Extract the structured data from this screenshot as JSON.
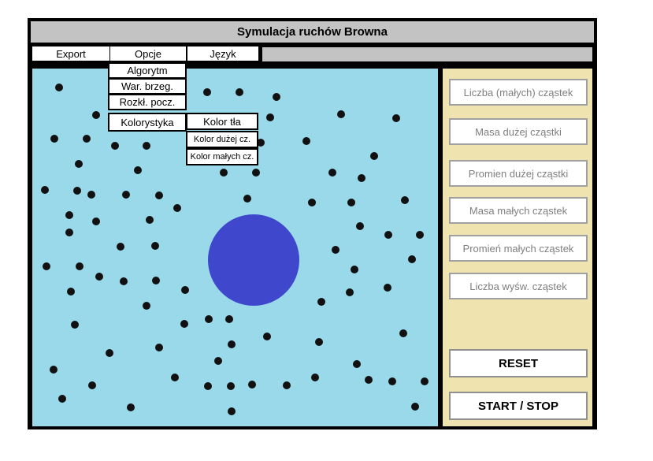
{
  "window": {
    "title": "Symulacja ruchów Browna"
  },
  "menubar": {
    "export": "Export",
    "opcje": "Opcje",
    "jezyk": "Język"
  },
  "opcje_menu": {
    "algorytm": "Algorytm",
    "war_brzeg": "War. brzeg.",
    "rozkl_pocz": "Rozkł. pocz.",
    "kolorystyka": "Kolorystyka"
  },
  "kolorystyka_menu": {
    "kolor_tla": "Kolor tła",
    "kolor_duzej": "Kolor dużej cz.",
    "kolor_malych": "Kolor małych cz."
  },
  "side_panel": {
    "fields": [
      {
        "placeholder": "Liczba (małych) cząstek"
      },
      {
        "placeholder": "Masa dużej cząstki"
      },
      {
        "placeholder": "Promien dużej cząstki"
      },
      {
        "placeholder": "Masa małych cząstek"
      },
      {
        "placeholder": "Promień małych cząstek"
      },
      {
        "placeholder": "Liczba wyśw. cząstek"
      }
    ],
    "reset_label": "RESET",
    "start_stop_label": "START / STOP"
  },
  "colors": {
    "background": "#99d9ea",
    "big_particle": "#3f48cc",
    "small_particles": "#111111",
    "side_panel": "#efe4b0",
    "title_bar": "#c3c3c3"
  }
}
